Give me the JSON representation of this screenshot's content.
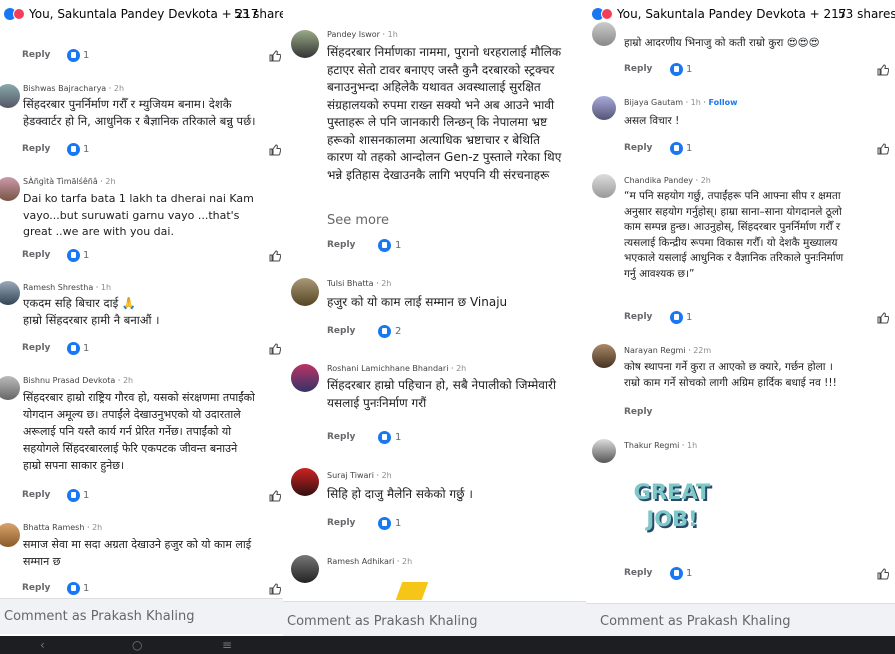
{
  "header": {
    "names": "You, Sakuntala Pandey Devkota + 217",
    "shares": "53 shares"
  },
  "comment_placeholder": "Comment as Prakash Khaling",
  "reply_label": "Reply",
  "panel1": {
    "top_count": "1",
    "comments": [
      {
        "name": "Bishwas Bajracharya",
        "time": "2h",
        "lines": [
          "सिंहदरबार पुनर्निर्माण गरौँ र म्युजियम बनाम। देशकै",
          "हेडक्वार्टर हो नि, आधुनिक र बैज्ञानिक तरिकाले बन्नु पर्छ।"
        ],
        "likes": "1"
      },
      {
        "name": "SÀñgìtà Tìmãlśêñâ",
        "time": "2h",
        "lines": [
          "Dai ko tarfa bata 1 lakh ta dherai nai Kam",
          "vayo...but suruwati garnu vayo ...that's",
          "great ..we are with you dai."
        ],
        "likes": "1"
      },
      {
        "name": "Ramesh Shrestha",
        "time": "1h",
        "lines": [
          "एकदम सहि बिचार दाई 🙏",
          "हाम्रो सिंहदरबार हामी नै बनाऔं ।"
        ],
        "likes": "1"
      },
      {
        "name": "Bishnu Prasad Devkota",
        "time": "2h",
        "lines": [
          "सिंहदरबार हाम्रो राष्ट्रिय गौरव हो, यसको संरक्षणमा तपाईंको",
          "योगदान अमूल्य छ। तपाईंले देखाउनुभएको यो उदारताले",
          "अरूलाई पनि यस्तै कार्य गर्न प्रेरित गर्नेछ। तपाईंको यो",
          "सहयोगले सिंहदरबारलाई फेरि एकपटक जीवन्त बनाउने",
          "हाम्रो सपना साकार हुनेछ।"
        ],
        "likes": "1"
      },
      {
        "name": "Bhatta Ramesh",
        "time": "2h",
        "lines": [
          "समाज सेवा मा सदा अग्रता देखाउने हजुर को यो काम लाई",
          "सम्मान छ"
        ],
        "likes": "1"
      }
    ]
  },
  "panel2": {
    "comments": [
      {
        "name": "Pandey Iswor",
        "time": "1h",
        "lines": [
          "सिंहदरबार निर्माणका नाममा, पुरानो धरहरालाई मौलिक",
          "हटाएर सेतो टावर बनाएए जस्तै कुनै दरबारको स्ट्रक्चर",
          "बनाउनुभन्दा अहिलेकै यथावत अवस्थालाई सुरक्षित",
          "संग्रहालयको रुपमा राख्न सक्यो भने अब आउने भावी",
          "पुस्ताहरू ले पनि जानकारी लिन्छन् कि नेपालमा भ्रष्ट",
          "हरूको शासनकालमा अत्याधिक भ्रष्टाचार र बेथिति",
          "कारण यो तहको आन्दोलन Gen-z पुस्ताले गरेका थिए",
          "भन्ने इतिहास देखाउनकै लागि भएपनि यी संरचनाहरू"
        ],
        "see_more": "See more",
        "likes": "1"
      },
      {
        "name": "Tulsi Bhatta",
        "time": "2h",
        "lines": [
          "हजुर को यो काम लाई  सम्मान  छ  Vinaju"
        ],
        "likes": "2"
      },
      {
        "name": "Roshani Lamichhane Bhandari",
        "time": "2h",
        "lines": [
          "सिंहदरबार हाम्रो पहिचान हो, सबै नेपालीको जिम्मेवारी",
          "यसलाई पुनःनिर्माण गरौं"
        ],
        "likes": "1"
      },
      {
        "name": "Suraj Tiwari",
        "time": "2h",
        "lines": [
          "सिहि हो दाजु मैलेनि सकेको गर्छु ।"
        ],
        "likes": "1"
      },
      {
        "name": "Ramesh Adhikari",
        "time": "2h",
        "lines": []
      }
    ]
  },
  "panel3": {
    "comments": [
      {
        "name": "",
        "time": "",
        "lines": [
          "हाम्रो आदरणीय भिनाजु को कती राम्रो कुरा 😍😍😍"
        ],
        "likes": "1"
      },
      {
        "name": "Bijaya Gautam",
        "time": "1h",
        "follow": "Follow",
        "lines": [
          "असल विचार !"
        ],
        "likes": "1"
      },
      {
        "name": "Chandika Pandey",
        "time": "2h",
        "lines": [
          "“म पनि सहयोग गर्छु, तपाईंहरू पनि आफ्ना सीप र क्षमता",
          "अनुसार सहयोग गर्नुहोस्। हाम्रा साना–साना योगदानले ठूलो",
          "काम सम्पन्न हुन्छ। आउनुहोस्, सिंहदरबार पुनर्निर्माण गरौँ र",
          "त्यसलाई किन्द्रीय रूपमा विकास गरौँ। यो देशकै मुख्यालय",
          "भएकाले यसलाई आधुनिक र वैज्ञानिक तरिकाले पुनःनिर्माण",
          "गर्नु आवश्यक छ।”"
        ],
        "likes": "1"
      },
      {
        "name": "Narayan Regmi",
        "time": "22m",
        "lines": [
          "कोष स्थापना गर्ने कुरा त आएको छ क्यारे, गर्छन होला ।",
          "राम्रो काम गर्ने सोचको लागी अग्रिम हार्दिक बधाई नव !!!"
        ]
      },
      {
        "name": "Thakur Regmi",
        "time": "1h",
        "sticker": [
          "GREAT",
          "JOB!"
        ],
        "lines": [],
        "likes": "1"
      }
    ]
  },
  "colors": {
    "accent": "#1877f2",
    "love": "#f33e58",
    "bg": "#ffffff"
  }
}
